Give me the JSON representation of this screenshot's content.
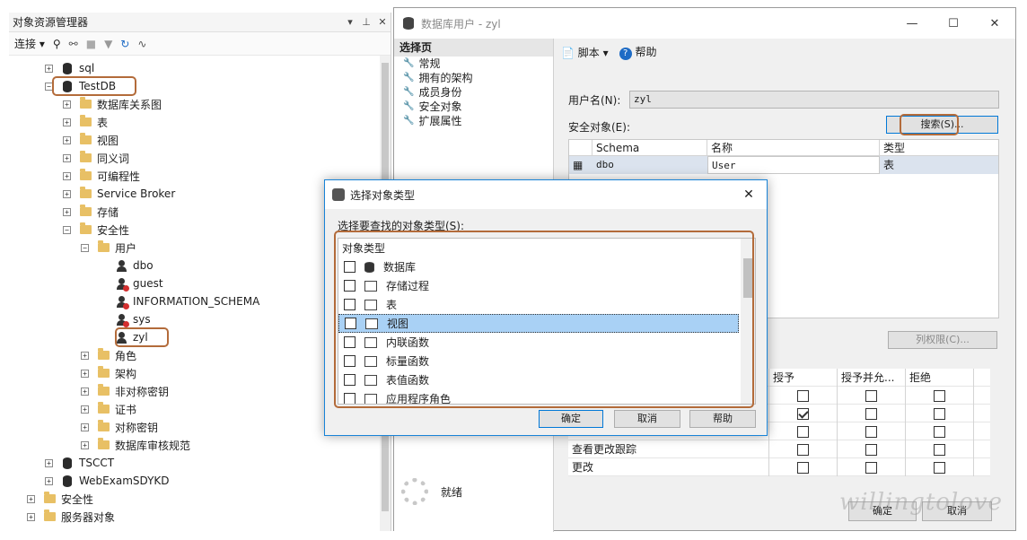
{
  "object_explorer": {
    "title": "对象资源管理器",
    "pin_glyphs": [
      "▾",
      "⊥",
      "✕"
    ],
    "toolbar_connect": "连接",
    "tree": [
      {
        "label": "sql",
        "expander": "+",
        "icon": "database-icon"
      },
      {
        "label": "TestDB",
        "expander": "−",
        "icon": "database-icon"
      },
      {
        "label": "数据库关系图",
        "expander": "+",
        "icon": "folder-icon"
      },
      {
        "label": "表",
        "expander": "+",
        "icon": "folder-icon"
      },
      {
        "label": "视图",
        "expander": "+",
        "icon": "folder-icon"
      },
      {
        "label": "同义词",
        "expander": "+",
        "icon": "folder-icon"
      },
      {
        "label": "可编程性",
        "expander": "+",
        "icon": "folder-icon"
      },
      {
        "label": "Service Broker",
        "expander": "+",
        "icon": "folder-icon"
      },
      {
        "label": "存储",
        "expander": "+",
        "icon": "folder-icon"
      },
      {
        "label": "安全性",
        "expander": "−",
        "icon": "folder-icon"
      },
      {
        "label": "用户",
        "expander": "−",
        "icon": "folder-icon"
      },
      {
        "label": "dbo",
        "icon": "user-icon"
      },
      {
        "label": "guest",
        "icon": "user-disabled-icon"
      },
      {
        "label": "INFORMATION_SCHEMA",
        "icon": "user-disabled-icon"
      },
      {
        "label": "sys",
        "icon": "user-disabled-icon"
      },
      {
        "label": "zyl",
        "icon": "user-icon"
      },
      {
        "label": "角色",
        "expander": "+",
        "icon": "folder-icon"
      },
      {
        "label": "架构",
        "expander": "+",
        "icon": "folder-icon"
      },
      {
        "label": "非对称密钥",
        "expander": "+",
        "icon": "folder-icon"
      },
      {
        "label": "证书",
        "expander": "+",
        "icon": "folder-icon"
      },
      {
        "label": "对称密钥",
        "expander": "+",
        "icon": "folder-icon"
      },
      {
        "label": "数据库审核规范",
        "expander": "+",
        "icon": "folder-icon"
      },
      {
        "label": "TSCCT",
        "expander": "+",
        "icon": "database-icon"
      },
      {
        "label": "WebExamSDYKD",
        "expander": "+",
        "icon": "database-icon"
      },
      {
        "label": "安全性",
        "expander": "+",
        "icon": "folder-icon"
      },
      {
        "label": "服务器对象",
        "expander": "+",
        "icon": "folder-icon"
      }
    ]
  },
  "user_window": {
    "title": "数据库用户 - zyl",
    "select_page_header": "选择页",
    "pages": [
      "常规",
      "拥有的架构",
      "成员身份",
      "安全对象",
      "扩展属性"
    ],
    "toolbar": {
      "script": "脚本",
      "help": "帮助"
    },
    "username_label": "用户名(N):",
    "username_value": "zyl",
    "securables_label": "安全对象(E):",
    "search_button": "搜索(S)...",
    "grid_headers": [
      "Schema",
      "名称",
      "类型"
    ],
    "grid_row": {
      "schema": "dbo",
      "name": "User",
      "type": "表"
    },
    "column_perms_button": "列权限(C)...",
    "perm_headers": [
      "授予",
      "授予并允...",
      "拒绝"
    ],
    "perm_rows": [
      {
        "name": "",
        "grant": false,
        "with_grant": false,
        "deny": false
      },
      {
        "name": "",
        "grant": true,
        "with_grant": false,
        "deny": false
      },
      {
        "name": "",
        "grant": false,
        "with_grant": false,
        "deny": false
      },
      {
        "name": "查看更改跟踪",
        "grant": false,
        "with_grant": false,
        "deny": false
      },
      {
        "name": "更改",
        "grant": false,
        "with_grant": false,
        "deny": false
      }
    ],
    "status_text": "就绪",
    "ok_button": "确定",
    "cancel_button": "取消",
    "watermark": "willingtolove"
  },
  "dialog": {
    "title": "选择对象类型",
    "instruction": "选择要查找的对象类型(S):",
    "list_header": "对象类型",
    "items": [
      {
        "label": "数据库",
        "checked": false,
        "selected": false
      },
      {
        "label": "存储过程",
        "checked": false,
        "selected": false
      },
      {
        "label": "表",
        "checked": false,
        "selected": false
      },
      {
        "label": "视图",
        "checked": false,
        "selected": true
      },
      {
        "label": "内联函数",
        "checked": false,
        "selected": false
      },
      {
        "label": "标量函数",
        "checked": false,
        "selected": false
      },
      {
        "label": "表值函数",
        "checked": false,
        "selected": false
      },
      {
        "label": "应用程序角色",
        "checked": false,
        "selected": false
      }
    ],
    "ok_button": "确定",
    "cancel_button": "取消",
    "help_button": "帮助"
  },
  "colors": {
    "highlight_ring": "#b36b3a",
    "accent": "#0078d7",
    "selection": "#a9d1f5"
  }
}
